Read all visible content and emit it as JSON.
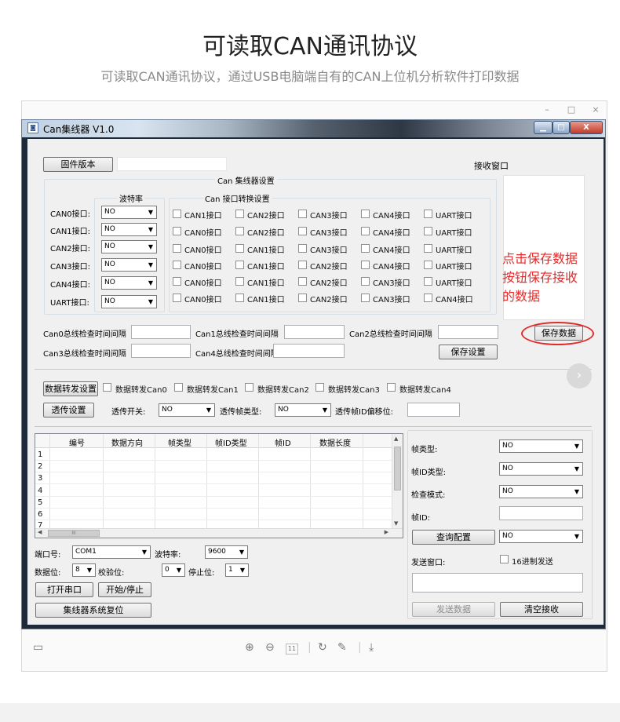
{
  "header": {
    "title": "可读取CAN通讯协议",
    "subtitle": "可读取CAN通讯协议，通过USB电脑端自有的CAN上位机分析软件打印数据"
  },
  "viewer": {
    "controls": {
      "minimize": "–",
      "maximize": "□",
      "close": "×"
    },
    "toolbar": {
      "page_number": "11"
    }
  },
  "window": {
    "icon": "app-icon",
    "title": "Can集线器 V1.0",
    "close_glyph": "X"
  },
  "top": {
    "firmware_button": "固件版本",
    "firmware_value": "",
    "receive_window_label": "接收窗口",
    "group_title": "Can 集线器设置"
  },
  "hub_settings": {
    "baud_header": "波特率",
    "conv_header": "Can 接口转换设置",
    "rows": [
      {
        "label": "CAN0接口:",
        "baud": "NO",
        "options": [
          "CAN1接口",
          "CAN2接口",
          "CAN3接口",
          "CAN4接口",
          "UART接口"
        ]
      },
      {
        "label": "CAN1接口:",
        "baud": "NO",
        "options": [
          "CAN0接口",
          "CAN2接口",
          "CAN3接口",
          "CAN4接口",
          "UART接口"
        ]
      },
      {
        "label": "CAN2接口:",
        "baud": "NO",
        "options": [
          "CAN0接口",
          "CAN1接口",
          "CAN3接口",
          "CAN4接口",
          "UART接口"
        ]
      },
      {
        "label": "CAN3接口:",
        "baud": "NO",
        "options": [
          "CAN0接口",
          "CAN1接口",
          "CAN2接口",
          "CAN4接口",
          "UART接口"
        ]
      },
      {
        "label": "CAN4接口:",
        "baud": "NO",
        "options": [
          "CAN0接口",
          "CAN1接口",
          "CAN2接口",
          "CAN3接口",
          "UART接口"
        ]
      },
      {
        "label": "UART接口:",
        "baud": "NO",
        "options": [
          "CAN0接口",
          "CAN1接口",
          "CAN2接口",
          "CAN3接口",
          "CAN4接口"
        ]
      }
    ]
  },
  "intervals": {
    "can0_label": "Can0总线检查时间间隔",
    "can0_value": "",
    "can1_label": "Can1总线检查时间间隔",
    "can1_value": "",
    "can2_label": "Can2总线检查时间间隔",
    "can2_value": "",
    "can3_label": "Can3总线检查时间间隔",
    "can3_value": "",
    "can4_label": "Can4总线检查时间间隔",
    "can4_value": "",
    "save_settings_button": "保存设置",
    "save_data_button": "保存数据"
  },
  "annotation": {
    "line1": "点击保存数据",
    "line2": "按钮保存接收",
    "line3": "的数据"
  },
  "forward": {
    "forward_settings_button": "数据转发设置",
    "checkboxes": [
      "数据转发Can0",
      "数据转发Can1",
      "数据转发Can2",
      "数据转发Can3",
      "数据转发Can4"
    ],
    "passthrough_button": "透传设置",
    "switch_label": "透传开关:",
    "switch_value": "NO",
    "frame_type_label": "透传帧类型:",
    "frame_type_value": "NO",
    "id_offset_label": "透传帧ID偏移位:",
    "id_offset_value": ""
  },
  "grid": {
    "columns": [
      "编号",
      "数据方向",
      "帧类型",
      "帧ID类型",
      "帧ID",
      "数据长度"
    ],
    "row_numbers": [
      "1",
      "2",
      "3",
      "4",
      "5",
      "6",
      "7"
    ],
    "hscroll_grip": "III"
  },
  "serial": {
    "port_label": "端口号:",
    "port_value": "COM1",
    "baud_label": "波特率:",
    "baud_value": "9600",
    "databits_label": "数据位:",
    "databits_value": "8",
    "parity_label": "校验位:",
    "parity_value": "0",
    "stopbits_label": "停止位:",
    "stopbits_value": "1",
    "open_button": "打开串口",
    "start_stop_button": "开始/停止",
    "reset_button": "集线器系统复位"
  },
  "right_panel": {
    "frame_type_label": "帧类型:",
    "frame_type_value": "NO",
    "frame_id_type_label": "帧ID类型:",
    "frame_id_type_value": "NO",
    "check_mode_label": "检查模式:",
    "check_mode_value": "NO",
    "frame_id_label": "帧ID:",
    "frame_id_value": "",
    "query_button": "查询配置",
    "query_value": "NO",
    "send_window_label": "发送窗口:",
    "hex_send_label": "16进制发送",
    "send_value": "",
    "send_button": "发送数据",
    "clear_button": "清空接收"
  }
}
